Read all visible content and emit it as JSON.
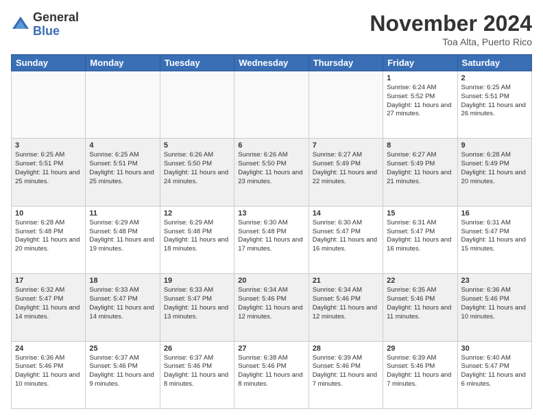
{
  "header": {
    "logo_general": "General",
    "logo_blue": "Blue",
    "month_title": "November 2024",
    "location": "Toa Alta, Puerto Rico"
  },
  "days_of_week": [
    "Sunday",
    "Monday",
    "Tuesday",
    "Wednesday",
    "Thursday",
    "Friday",
    "Saturday"
  ],
  "weeks": [
    [
      {
        "day": "",
        "content": ""
      },
      {
        "day": "",
        "content": ""
      },
      {
        "day": "",
        "content": ""
      },
      {
        "day": "",
        "content": ""
      },
      {
        "day": "",
        "content": ""
      },
      {
        "day": "1",
        "content": "Sunrise: 6:24 AM\nSunset: 5:52 PM\nDaylight: 11 hours and 27 minutes."
      },
      {
        "day": "2",
        "content": "Sunrise: 6:25 AM\nSunset: 5:51 PM\nDaylight: 11 hours and 26 minutes."
      }
    ],
    [
      {
        "day": "3",
        "content": "Sunrise: 6:25 AM\nSunset: 5:51 PM\nDaylight: 11 hours and 25 minutes."
      },
      {
        "day": "4",
        "content": "Sunrise: 6:25 AM\nSunset: 5:51 PM\nDaylight: 11 hours and 25 minutes."
      },
      {
        "day": "5",
        "content": "Sunrise: 6:26 AM\nSunset: 5:50 PM\nDaylight: 11 hours and 24 minutes."
      },
      {
        "day": "6",
        "content": "Sunrise: 6:26 AM\nSunset: 5:50 PM\nDaylight: 11 hours and 23 minutes."
      },
      {
        "day": "7",
        "content": "Sunrise: 6:27 AM\nSunset: 5:49 PM\nDaylight: 11 hours and 22 minutes."
      },
      {
        "day": "8",
        "content": "Sunrise: 6:27 AM\nSunset: 5:49 PM\nDaylight: 11 hours and 21 minutes."
      },
      {
        "day": "9",
        "content": "Sunrise: 6:28 AM\nSunset: 5:49 PM\nDaylight: 11 hours and 20 minutes."
      }
    ],
    [
      {
        "day": "10",
        "content": "Sunrise: 6:28 AM\nSunset: 5:48 PM\nDaylight: 11 hours and 20 minutes."
      },
      {
        "day": "11",
        "content": "Sunrise: 6:29 AM\nSunset: 5:48 PM\nDaylight: 11 hours and 19 minutes."
      },
      {
        "day": "12",
        "content": "Sunrise: 6:29 AM\nSunset: 5:48 PM\nDaylight: 11 hours and 18 minutes."
      },
      {
        "day": "13",
        "content": "Sunrise: 6:30 AM\nSunset: 5:48 PM\nDaylight: 11 hours and 17 minutes."
      },
      {
        "day": "14",
        "content": "Sunrise: 6:30 AM\nSunset: 5:47 PM\nDaylight: 11 hours and 16 minutes."
      },
      {
        "day": "15",
        "content": "Sunrise: 6:31 AM\nSunset: 5:47 PM\nDaylight: 11 hours and 16 minutes."
      },
      {
        "day": "16",
        "content": "Sunrise: 6:31 AM\nSunset: 5:47 PM\nDaylight: 11 hours and 15 minutes."
      }
    ],
    [
      {
        "day": "17",
        "content": "Sunrise: 6:32 AM\nSunset: 5:47 PM\nDaylight: 11 hours and 14 minutes."
      },
      {
        "day": "18",
        "content": "Sunrise: 6:33 AM\nSunset: 5:47 PM\nDaylight: 11 hours and 14 minutes."
      },
      {
        "day": "19",
        "content": "Sunrise: 6:33 AM\nSunset: 5:47 PM\nDaylight: 11 hours and 13 minutes."
      },
      {
        "day": "20",
        "content": "Sunrise: 6:34 AM\nSunset: 5:46 PM\nDaylight: 11 hours and 12 minutes."
      },
      {
        "day": "21",
        "content": "Sunrise: 6:34 AM\nSunset: 5:46 PM\nDaylight: 11 hours and 12 minutes."
      },
      {
        "day": "22",
        "content": "Sunrise: 6:35 AM\nSunset: 5:46 PM\nDaylight: 11 hours and 11 minutes."
      },
      {
        "day": "23",
        "content": "Sunrise: 6:36 AM\nSunset: 5:46 PM\nDaylight: 11 hours and 10 minutes."
      }
    ],
    [
      {
        "day": "24",
        "content": "Sunrise: 6:36 AM\nSunset: 5:46 PM\nDaylight: 11 hours and 10 minutes."
      },
      {
        "day": "25",
        "content": "Sunrise: 6:37 AM\nSunset: 5:46 PM\nDaylight: 11 hours and 9 minutes."
      },
      {
        "day": "26",
        "content": "Sunrise: 6:37 AM\nSunset: 5:46 PM\nDaylight: 11 hours and 8 minutes."
      },
      {
        "day": "27",
        "content": "Sunrise: 6:38 AM\nSunset: 5:46 PM\nDaylight: 11 hours and 8 minutes."
      },
      {
        "day": "28",
        "content": "Sunrise: 6:39 AM\nSunset: 5:46 PM\nDaylight: 11 hours and 7 minutes."
      },
      {
        "day": "29",
        "content": "Sunrise: 6:39 AM\nSunset: 5:46 PM\nDaylight: 11 hours and 7 minutes."
      },
      {
        "day": "30",
        "content": "Sunrise: 6:40 AM\nSunset: 5:47 PM\nDaylight: 11 hours and 6 minutes."
      }
    ]
  ]
}
